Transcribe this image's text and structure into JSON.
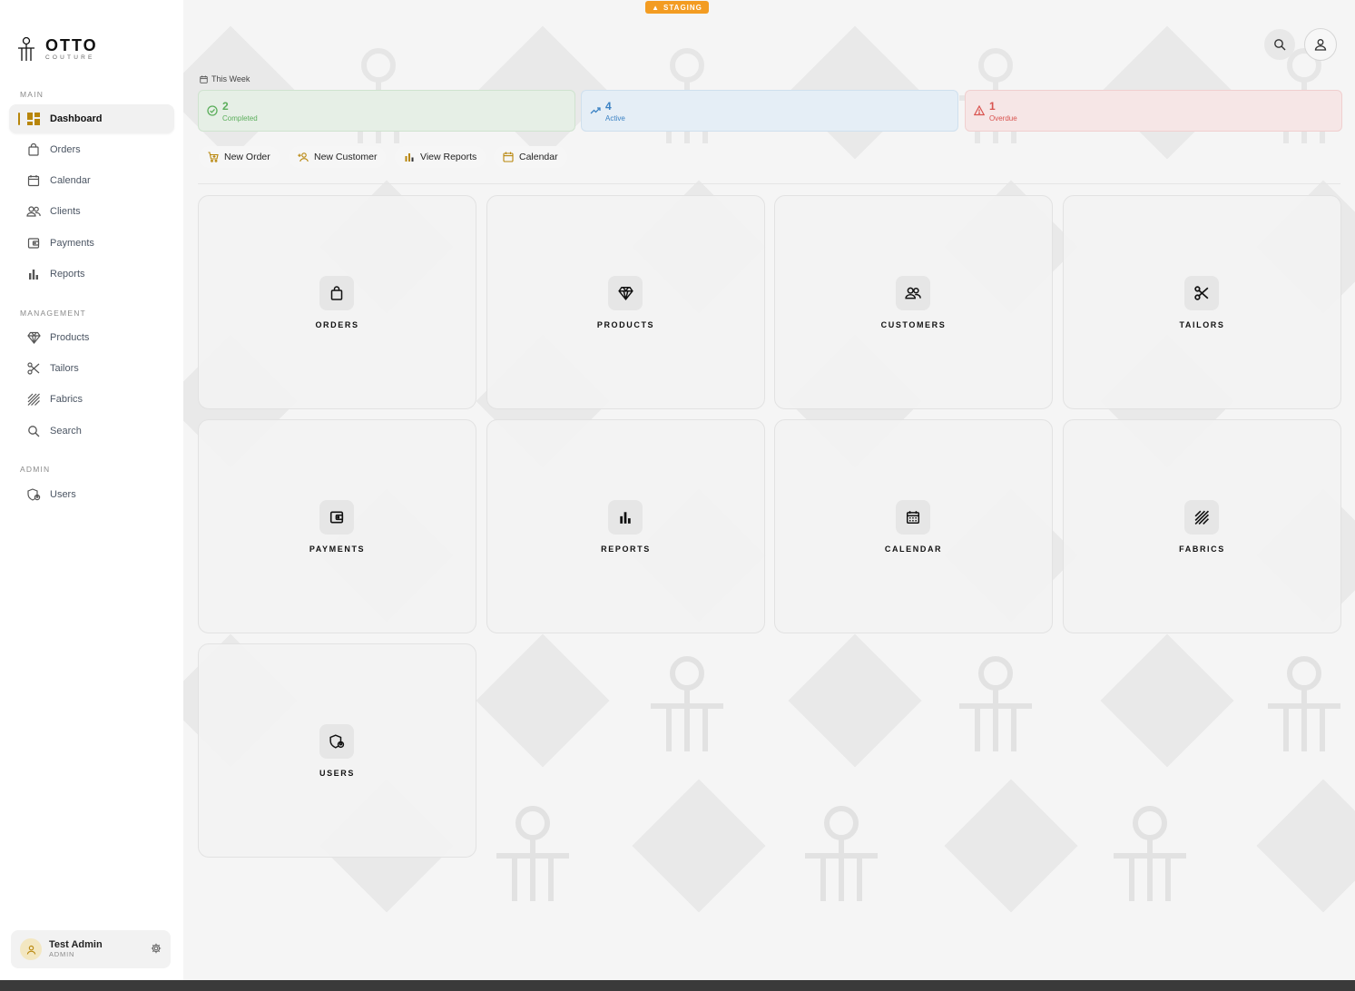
{
  "brand": {
    "name": "OTTO",
    "subtitle": "COUTURE",
    "accent": "#b8860b"
  },
  "environment_badge": "STAGING",
  "sidebar": {
    "sections": [
      {
        "label": "MAIN",
        "items": [
          {
            "label": "Dashboard",
            "icon": "dashboard-icon",
            "active": true
          },
          {
            "label": "Orders",
            "icon": "shopping-bag-icon"
          },
          {
            "label": "Calendar",
            "icon": "calendar-icon"
          },
          {
            "label": "Clients",
            "icon": "users-icon"
          },
          {
            "label": "Payments",
            "icon": "wallet-icon"
          },
          {
            "label": "Reports",
            "icon": "bar-chart-icon"
          }
        ]
      },
      {
        "label": "MANAGEMENT",
        "items": [
          {
            "label": "Products",
            "icon": "diamond-icon"
          },
          {
            "label": "Tailors",
            "icon": "scissors-icon"
          },
          {
            "label": "Fabrics",
            "icon": "fabric-icon"
          },
          {
            "label": "Search",
            "icon": "search-icon"
          }
        ]
      },
      {
        "label": "ADMIN",
        "items": [
          {
            "label": "Users",
            "icon": "user-shield-icon"
          }
        ]
      }
    ],
    "user": {
      "name": "Test Admin",
      "role": "ADMIN"
    }
  },
  "this_week": {
    "label": "This Week",
    "stats": [
      {
        "value": "2",
        "label": "Completed",
        "color": "#5bae5b"
      },
      {
        "value": "4",
        "label": "Active",
        "color": "#3b82c4"
      },
      {
        "value": "1",
        "label": "Overdue",
        "color": "#d9534f"
      }
    ]
  },
  "quick_actions": [
    "New Order",
    "New Customer",
    "View Reports",
    "Calendar"
  ],
  "tiles": [
    "ORDERS",
    "PRODUCTS",
    "CUSTOMERS",
    "TAILORS",
    "PAYMENTS",
    "REPORTS",
    "CALENDAR",
    "FABRICS",
    "USERS"
  ]
}
